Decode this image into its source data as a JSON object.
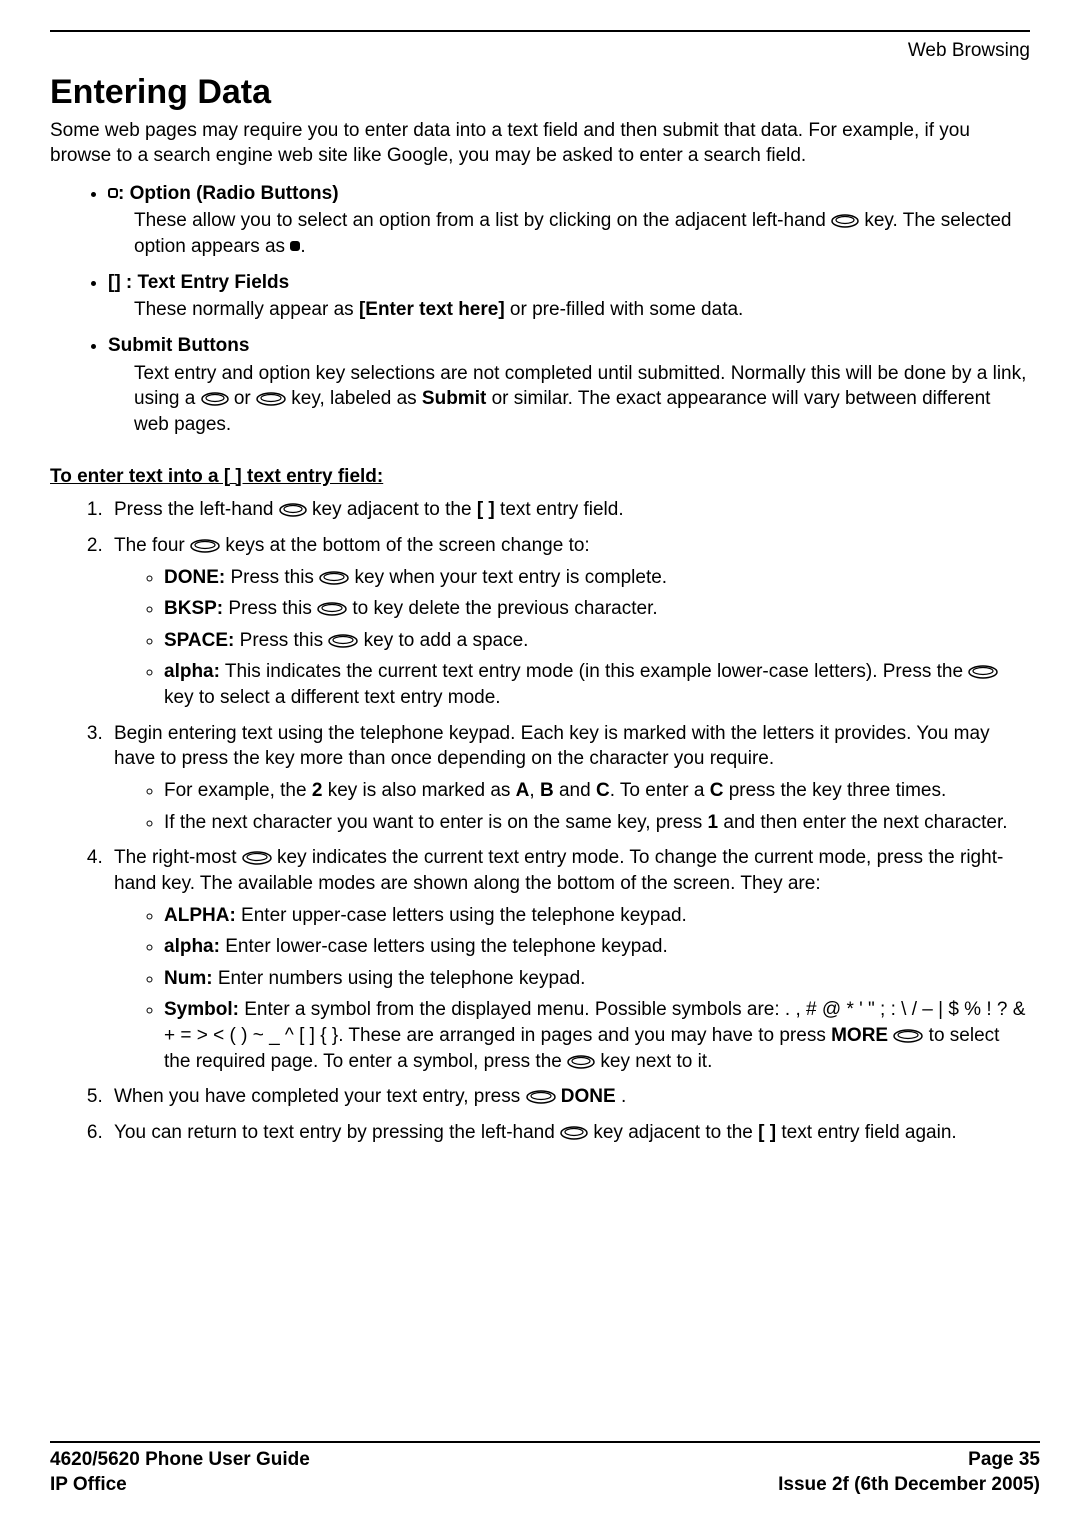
{
  "header_right": "Web Browsing",
  "title": "Entering Data",
  "intro_1": "Some web pages may require you to enter data into a text field and then submit that data. For example, if you browse to a search engine web site like Google, you may be asked to enter a search field.",
  "opt_head": ": Option (Radio Buttons)",
  "opt_body_1": "These allow you to select an option from a list by clicking on the adjacent left-hand ",
  "opt_body_2": " key. The selected option appears as ",
  "opt_body_3": ".",
  "txt_head": "[] : Text Entry Fields",
  "txt_body_1": "These normally appear as ",
  "txt_body_bold": "[Enter text here]",
  "txt_body_2": " or pre-filled with some data.",
  "sub_head": "Submit Buttons",
  "sub_body_1": "Text entry and option key selections are not completed until submitted. Normally this will be done by a link, using a ",
  "sub_body_2": " or ",
  "sub_body_3": " key, labeled as ",
  "sub_body_bold": "Submit",
  "sub_body_4": " or similar. The exact appearance will vary between different web pages.",
  "section_head": "To enter text into a [ ] text entry field:",
  "s1_a": "Press the left-hand ",
  "s1_b": " key adjacent to the ",
  "s1_bold": "[ ]",
  "s1_c": " text entry field.",
  "s2_a": "The four ",
  "s2_b": " keys at the bottom of the screen change to:",
  "s2_done_label": "DONE:",
  "s2_done_a": " Press this ",
  "s2_done_b": " key when your text entry is complete.",
  "s2_bksp_label": "BKSP:",
  "s2_bksp_a": " Press this ",
  "s2_bksp_b": " to key delete the previous character.",
  "s2_space_label": "SPACE:",
  "s2_space_a": " Press this ",
  "s2_space_b": " key to add a space.",
  "s2_alpha_label": "alpha:",
  "s2_alpha_a": " This indicates the current text entry mode (in this example lower-case letters). Press the ",
  "s2_alpha_b": " key to select a different text entry mode.",
  "s3": "Begin entering text using the telephone keypad. Each key is marked with the letters it provides. You may have to press the key more than once depending on the character you require.",
  "s3_a_1": "For example, the ",
  "s3_a_b2": "2",
  "s3_a_2": " key is also marked as ",
  "s3_a_bA": "A",
  "s3_a_3": ", ",
  "s3_a_bB": "B",
  "s3_a_4": " and ",
  "s3_a_bC": "C",
  "s3_a_5": ". To enter a ",
  "s3_a_bC2": "C",
  "s3_a_6": " press the key three times.",
  "s3_b_1": "If the next character you want to enter is on the same key, press ",
  "s3_b_b1": "1",
  "s3_b_2": " and then enter the next character.",
  "s4_a": "The right-most ",
  "s4_b": " key indicates the current text entry mode. To change the current mode, press the right-hand key. The available modes are shown along the bottom of the screen. They are:",
  "s4_alpha_u_label": "ALPHA:",
  "s4_alpha_u_a": " Enter upper-case letters using the telephone keypad.",
  "s4_alpha_l_label": "alpha:",
  "s4_alpha_l_a": " Enter lower-case letters using the telephone keypad.",
  "s4_num_label": "Num:",
  "s4_num_a": " Enter numbers using the telephone keypad.",
  "s4_sym_label": "Symbol:",
  "s4_sym_a": " Enter a symbol from the displayed menu. Possible symbols are: . , # @ * ' \" ; : \\ / – | $ % ! ? & + = > < ( ) ~ _ ^ [ ] { }. These are arranged in pages and you may have to press ",
  "s4_sym_bmore": "MORE",
  "s4_sym_b": " to select the required page. To enter a symbol, press the ",
  "s4_sym_c": " key next to it.",
  "s5_a": "When you have completed your text entry, press ",
  "s5_b": " ",
  "s5_bold": "DONE",
  "s5_c": " .",
  "s6_a": "You can return to text entry by pressing the left-hand ",
  "s6_b": " key adjacent to the ",
  "s6_bold": "[ ]",
  "s6_c": " text entry field again.",
  "footer_left_1": "4620/5620 Phone User Guide",
  "footer_left_2": "IP Office",
  "footer_right_1": "Page 35",
  "footer_right_2": "Issue 2f (6th December 2005)"
}
